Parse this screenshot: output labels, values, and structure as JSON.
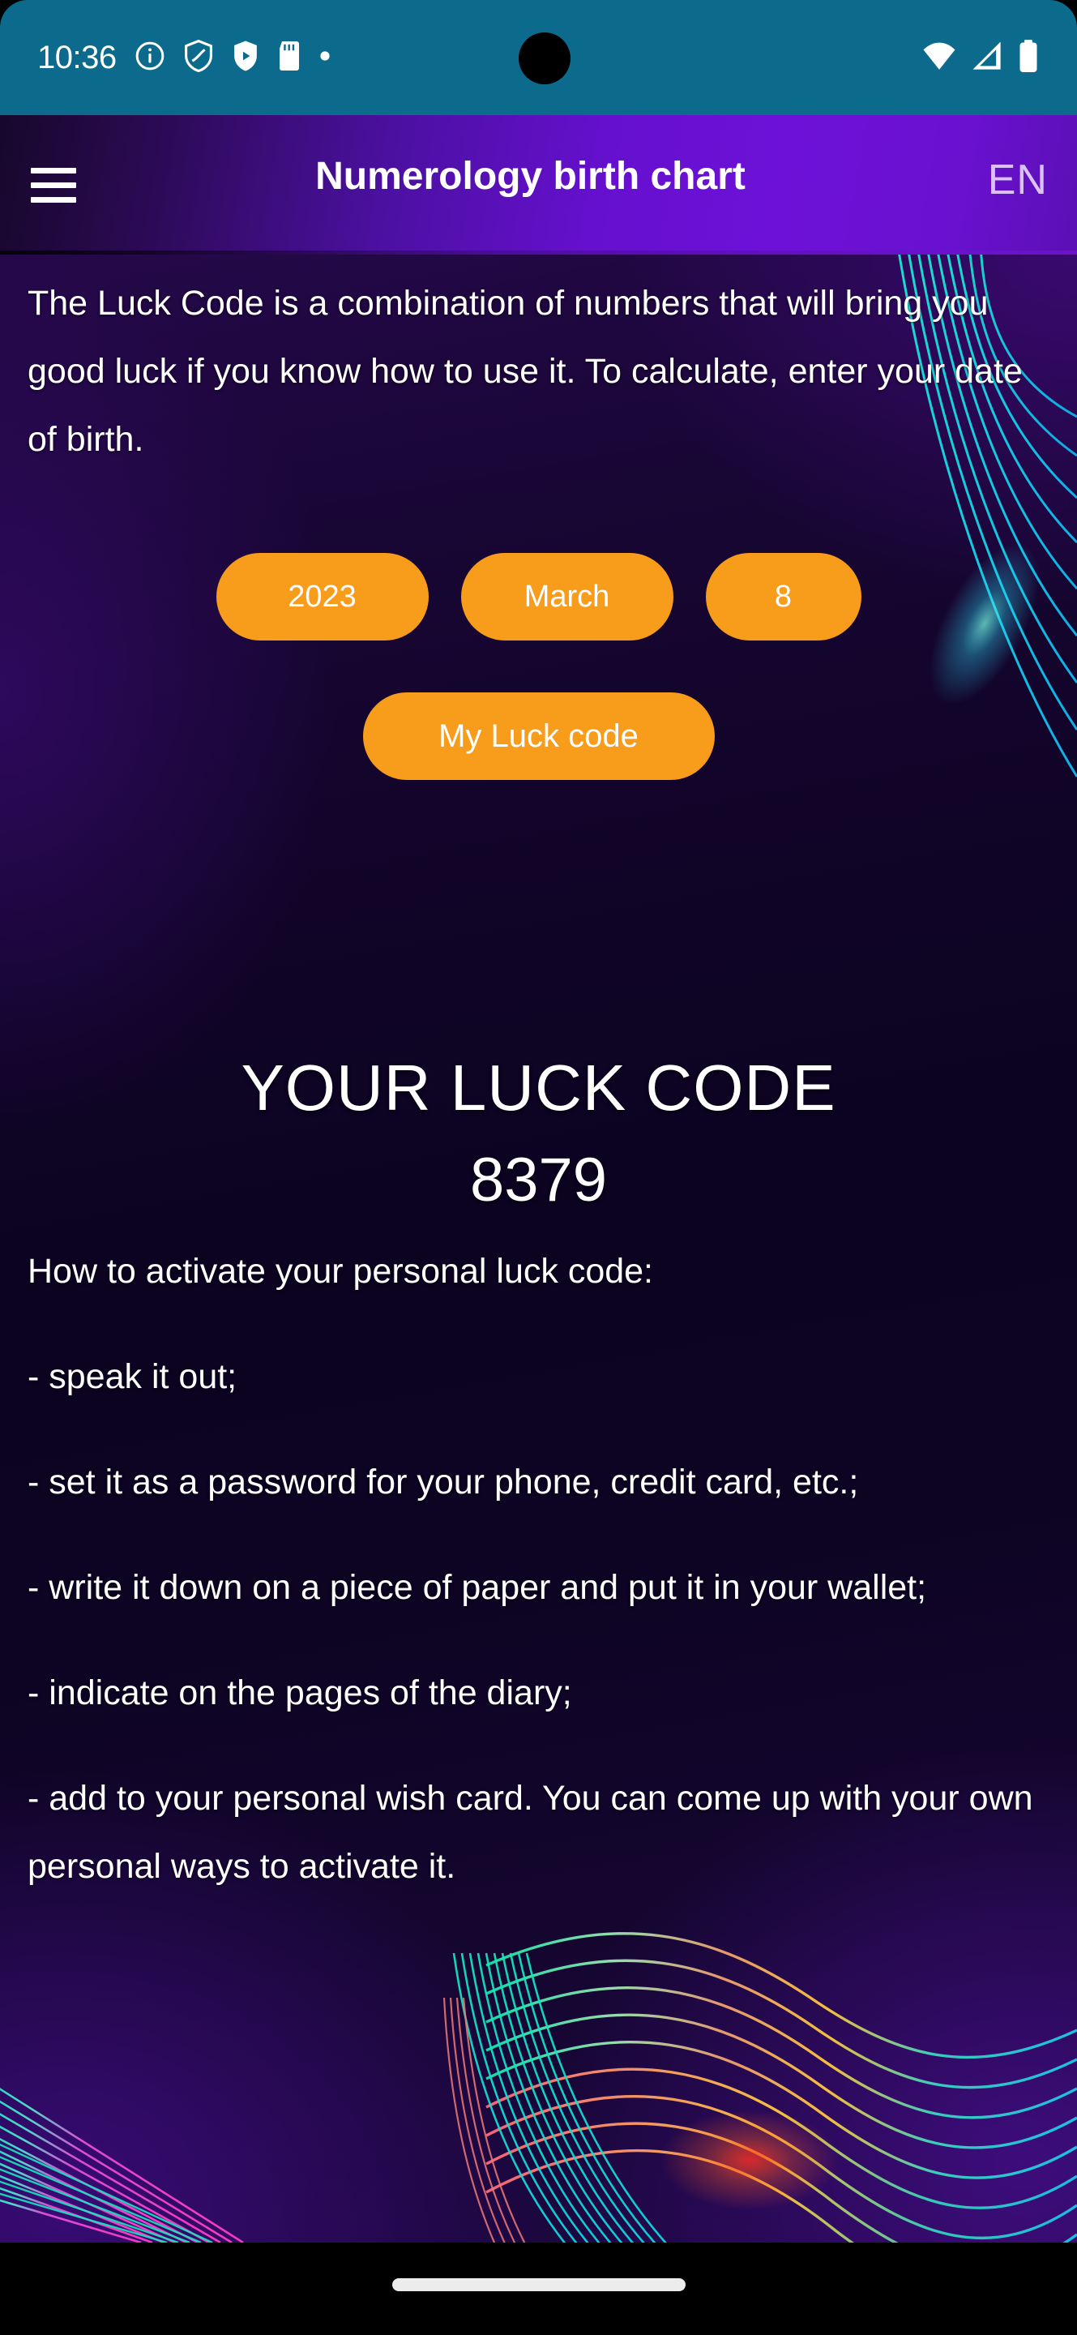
{
  "status_bar": {
    "clock": "10:36",
    "left_icons": [
      "info-circle-icon",
      "shield-icon",
      "play-shield-icon",
      "sd-card-icon",
      "dot-icon"
    ],
    "right_icons": [
      "wifi-icon",
      "cellular-signal-icon",
      "battery-icon"
    ],
    "background_color": "#0c6a8c"
  },
  "app_bar": {
    "menu_icon": "hamburger-menu-icon",
    "title": "Numerology birth chart",
    "language": "EN",
    "accent_color": "#6610cf"
  },
  "intro": {
    "text": "The Luck Code is a combination of numbers that will bring you good luck if you know how to use it. To calculate, enter your date of birth."
  },
  "date_picker": {
    "year": "2023",
    "month": "March",
    "day": "8",
    "submit_label": "My Luck code",
    "button_color": "#f89c1b"
  },
  "result": {
    "title": "YOUR LUCK CODE",
    "code": "8379"
  },
  "instructions": {
    "heading": "How to activate your personal luck code:",
    "items": [
      "- speak it out;",
      "- set it as a password for your phone, credit card, etc.;",
      "- write it down on a piece of paper and put it in your wallet;",
      "- indicate on the pages of the diary;",
      "- add to your personal wish card. You can come up with your own personal ways to activate it."
    ]
  },
  "nav_bar": {
    "gesture_pill": "home-gesture-indicator"
  }
}
